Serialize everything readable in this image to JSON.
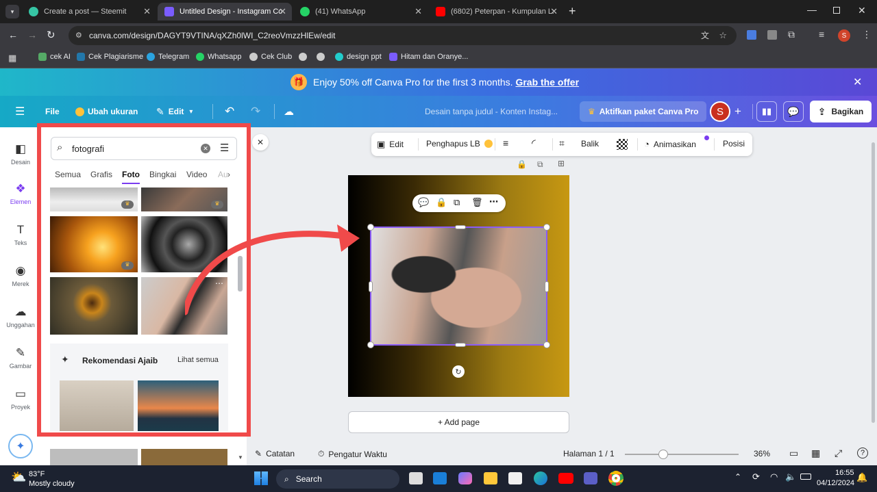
{
  "browser": {
    "tabs": [
      {
        "title": "Create a post — Steemit",
        "color": "#36c5a4"
      },
      {
        "title": "Untitled Design - Instagram Co",
        "color": "#7a5cff",
        "active": true
      },
      {
        "title": "(41) WhatsApp",
        "color": "#25d366"
      },
      {
        "title": "(6802) Peterpan - Kumpulan La",
        "color": "#ff0000"
      }
    ],
    "url": "canva.com/design/DAGYT9VTINA/qXZh0lWI_C2reoVmzzHlEw/edit",
    "bookmarks": [
      "cek AI",
      "Cek Plagiarisme",
      "Telegram",
      "Whatsapp",
      "Cek Club",
      "",
      "",
      "design ppt",
      "Hitam dan Oranye..."
    ],
    "profile_initial": "S"
  },
  "promo": {
    "text": "Enjoy 50% off Canva Pro for the first 3 months.",
    "link": "Grab the offer"
  },
  "toolbar": {
    "file": "File",
    "resize": "Ubah ukuran",
    "edit": "Edit",
    "doc_title": "Desain tanpa judul - Konten Instag...",
    "pro": "Aktifkan paket Canva Pro",
    "avatar": "S",
    "share": "Bagikan"
  },
  "rail": [
    "Desain",
    "Elemen",
    "Teks",
    "Merek",
    "Unggahan",
    "Gambar",
    "Proyek"
  ],
  "panel": {
    "search_value": "fotografi",
    "filters": [
      "Semua",
      "Grafis",
      "Foto",
      "Bingkai",
      "Video",
      "Au"
    ],
    "active_filter": "Foto",
    "recommend_title": "Rekomendasi Ajaib",
    "see_all": "Lihat semua"
  },
  "context_toolbar": {
    "edit": "Edit",
    "bg_remover": "Penghapus LB",
    "flip": "Balik",
    "animate": "Animasikan",
    "position": "Posisi"
  },
  "canvas": {
    "add_page": "+ Add page"
  },
  "footer": {
    "notes": "Catatan",
    "timer": "Pengatur Waktu",
    "page": "Halaman 1 / 1",
    "zoom": "36%"
  },
  "taskbar": {
    "temp": "83°F",
    "weather": "Mostly cloudy",
    "search": "Search",
    "time": "16:55",
    "date": "04/12/2024"
  }
}
